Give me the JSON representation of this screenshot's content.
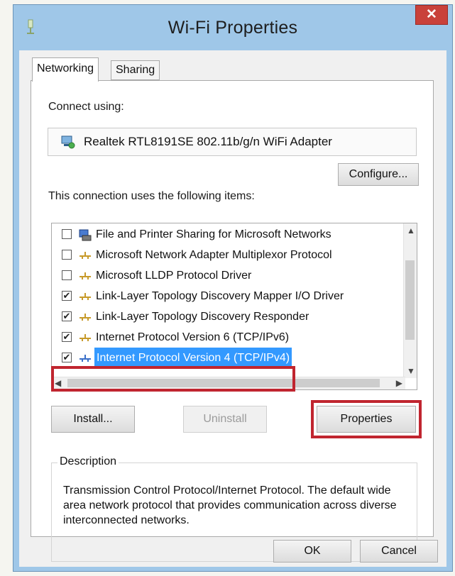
{
  "window": {
    "title": "Wi-Fi Properties",
    "close_glyph": "✕"
  },
  "tabs": [
    {
      "label": "Networking"
    },
    {
      "label": "Sharing"
    }
  ],
  "connect": {
    "label": "Connect using:",
    "adapter_name": "Realtek RTL8191SE 802.11b/g/n WiFi Adapter",
    "configure_label": "Configure..."
  },
  "items_label": "This connection uses the following items:",
  "items": [
    {
      "label": "File and Printer Sharing for Microsoft Networks",
      "checked": false,
      "icon": "network-share-icon"
    },
    {
      "label": "Microsoft Network Adapter Multiplexor Protocol",
      "checked": false,
      "icon": "protocol-icon"
    },
    {
      "label": "Microsoft LLDP Protocol Driver",
      "checked": false,
      "icon": "protocol-icon"
    },
    {
      "label": "Link-Layer Topology Discovery Mapper I/O Driver",
      "checked": true,
      "icon": "protocol-icon"
    },
    {
      "label": "Link-Layer Topology Discovery Responder",
      "checked": true,
      "icon": "protocol-icon"
    },
    {
      "label": "Internet Protocol Version 6 (TCP/IPv6)",
      "checked": true,
      "icon": "protocol-icon"
    },
    {
      "label": "Internet Protocol Version 4 (TCP/IPv4)",
      "checked": true,
      "icon": "protocol-icon",
      "selected": true
    }
  ],
  "buttons": {
    "install": "Install...",
    "uninstall": "Uninstall",
    "properties": "Properties",
    "ok": "OK",
    "cancel": "Cancel"
  },
  "description": {
    "title": "Description",
    "text": "Transmission Control Protocol/Internet Protocol. The default wide area network protocol that provides communication across diverse interconnected networks."
  },
  "colors": {
    "title_bar": "#9fc7e8",
    "close": "#c9413a",
    "selection": "#3399ff",
    "highlight_box": "#c0252f"
  },
  "check_glyph": "✔"
}
